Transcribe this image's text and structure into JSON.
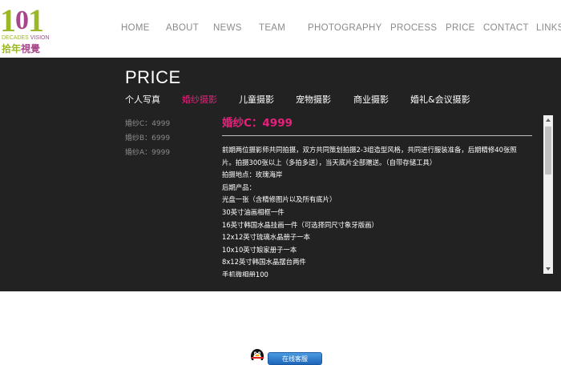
{
  "logo": {
    "digits_left": "1",
    "digits_mid": "0",
    "digits_right": "1",
    "english_left": "DECADES",
    "english_right": "VISION",
    "chinese_left": "拾年",
    "chinese_right": "視覺"
  },
  "nav": {
    "items": [
      "HOME",
      "ABOUT",
      "NEWS",
      "TEAM",
      "PHOTOGRAPHY",
      "PROCESS",
      "PRICE",
      "CONTACT",
      "LINKS"
    ]
  },
  "page": {
    "title": "PRICE"
  },
  "categories": {
    "items": [
      "个人写真",
      "婚纱摄影",
      "儿童摄影",
      "宠物摄影",
      "商业摄影",
      "婚礼&会议摄影"
    ],
    "active": "婚纱摄影"
  },
  "sidebar": {
    "items": [
      "婚纱C：4999",
      "婚纱B：6999",
      "婚纱A：9999"
    ]
  },
  "content": {
    "title": "婚纱C：4999",
    "lines": [
      "前期两位摄影师共同拍摄，双方共同策划拍摄2-3组造型风格，共同进行服装准备，后期精修40张照",
      "片。拍摄300张以上（多拍多送），当天底片全部赠送。（自带存储工具）",
      "拍摄地点：玫瑰海岸",
      "后期产品：",
      "光盘一张（含精修图片以及所有底片）",
      "30英寸油画相框一件",
      "16英寸韩国水晶挂画一件（可选择同尺寸象牙版画）",
      "12x12英寸琉璃水晶册子一本",
      "10x10英寸娘家册子一本",
      "8x12英寸韩国水晶摆台两件",
      "手机微相册100"
    ]
  },
  "qq_widget": {
    "button_label": "在线客服"
  },
  "colors": {
    "accent": "#e8207c",
    "band_background": "#222222",
    "logo_green": "#9ab826",
    "logo_purple": "#a7478a",
    "nav_text": "#8a8a8a"
  }
}
